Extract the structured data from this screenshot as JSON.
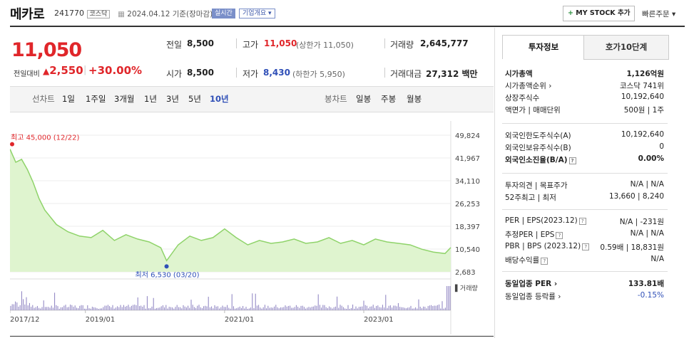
{
  "header": {
    "stock_name": "메카로",
    "stock_code": "241770",
    "market_badge": "코스닥",
    "date_text": "2024.04.12 기준(장마감)",
    "realtime_label": "실시간",
    "company_info_label": "기업개요 ▾",
    "my_stock_label": "MY STOCK 추가",
    "quick_order_label": "빠른주문 ▾"
  },
  "price": {
    "current": "11,050",
    "compare_label": "전일대비",
    "change": "2,550",
    "change_pct": "+30.00%",
    "up_color": "#e0262a",
    "down_color": "#2f4fb7"
  },
  "quote": {
    "prev_label": "전일",
    "prev_value": "8,500",
    "high_label": "고가",
    "high_value": "11,050",
    "upper_limit_text": "(상한가 11,050)",
    "volume_label": "거래량",
    "volume_value": "2,645,777",
    "open_label": "시가",
    "open_value": "8,500",
    "low_label": "저가",
    "low_value": "8,430",
    "lower_limit_text": "(하한가 5,950)",
    "amount_label": "거래대금",
    "amount_value": "27,312 백만"
  },
  "period": {
    "line_label": "선차트",
    "line_items": [
      "1일",
      "1주일",
      "3개월",
      "1년",
      "3년",
      "5년",
      "10년"
    ],
    "active_line": "10년",
    "candle_label": "봉차트",
    "candle_items": [
      "일봉",
      "주봉",
      "월봉"
    ]
  },
  "tabs": [
    "투자정보",
    "호가10단계"
  ],
  "info": {
    "g1": [
      {
        "label": "시가총액",
        "value": "1,126억원",
        "bold": true
      },
      {
        "label": "시가총액순위 ›",
        "value": "코스닥 741위"
      },
      {
        "label": "상장주식수",
        "value": "10,192,640"
      },
      {
        "label": "액면가 | 매매단위",
        "value": "500원 | 1주"
      }
    ],
    "g2": [
      {
        "label": "외국인한도주식수(A)",
        "value": "10,192,640"
      },
      {
        "label": "외국인보유주식수(B)",
        "value": "0"
      },
      {
        "label": "외국인소진율(B/A)",
        "value": "0.00%",
        "bold": true,
        "qm": true
      }
    ],
    "g3": [
      {
        "label": "투자의견 | 목표주가",
        "value": "N/A | N/A"
      },
      {
        "label": "52주최고 | 최저",
        "value": "13,660 | 8,240"
      }
    ],
    "g4": [
      {
        "label": "PER | EPS(2023.12)",
        "value": "N/A | -231원",
        "qm": true
      },
      {
        "label": "추정PER | EPS",
        "value": "N/A | N/A",
        "qm": true
      },
      {
        "label": "PBR | BPS (2023.12)",
        "value": "0.59배 | 18,831원",
        "qm": true
      },
      {
        "label": "배당수익률",
        "value": "N/A",
        "qm": true
      }
    ],
    "g5": [
      {
        "label": "동일업종 PER ›",
        "value": "133.81배",
        "bold": true
      },
      {
        "label": "동일업종 등락률 ›",
        "value": "-0.15%",
        "valcolor": "#2f4fb7"
      }
    ]
  },
  "chart_data": {
    "type": "area",
    "y_ticks": [
      "49,824",
      "41,967",
      "34,110",
      "26,253",
      "18,397",
      "10,540",
      "2,683"
    ],
    "ylim": [
      2683,
      49824
    ],
    "x_ticks": [
      "2017/12",
      "2019/01",
      "2021/01",
      "2023/01"
    ],
    "high_label": "최고 45,000 (12/22)",
    "low_label": "최저 6,530 (03/20)",
    "volume_label": "거래량",
    "series_color": "#8fd36a",
    "x": [
      "2017/12",
      "2018/01",
      "2018/02",
      "2018/03",
      "2018/04",
      "2018/05",
      "2018/06",
      "2018/08",
      "2018/10",
      "2018/12",
      "2019/02",
      "2019/04",
      "2019/06",
      "2019/08",
      "2019/10",
      "2019/12",
      "2020/02",
      "2020/03",
      "2020/05",
      "2020/07",
      "2020/09",
      "2020/11",
      "2021/01",
      "2021/03",
      "2021/05",
      "2021/07",
      "2021/09",
      "2021/11",
      "2022/01",
      "2022/03",
      "2022/05",
      "2022/07",
      "2022/09",
      "2022/11",
      "2023/01",
      "2023/03",
      "2023/05",
      "2023/07",
      "2023/09",
      "2023/11",
      "2024/01",
      "2024/03",
      "2024/04"
    ],
    "values": [
      45000,
      40500,
      41500,
      38000,
      33500,
      28000,
      24000,
      19000,
      16500,
      15000,
      14500,
      17000,
      13500,
      15500,
      14000,
      13000,
      11000,
      6530,
      12000,
      15000,
      13500,
      14500,
      17500,
      14500,
      12000,
      13500,
      12500,
      13000,
      14000,
      12500,
      13000,
      14500,
      12500,
      13500,
      12000,
      14000,
      13000,
      12500,
      12000,
      10500,
      9500,
      9000,
      11050
    ]
  }
}
